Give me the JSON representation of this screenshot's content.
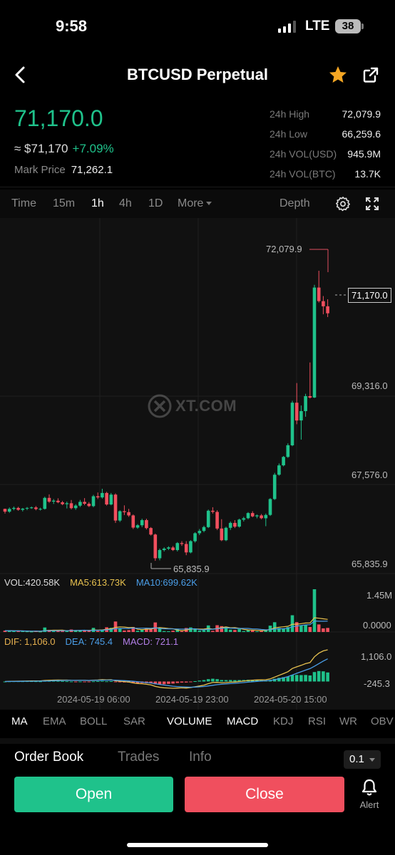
{
  "status_bar": {
    "time": "9:58",
    "network": "LTE",
    "battery": "38"
  },
  "header": {
    "title": "BTCUSD Perpetual"
  },
  "price": {
    "last": "71,170.0",
    "approx": "≈ $71,170",
    "change": "+7.09%",
    "mark_label": "Mark Price",
    "mark_value": "71,262.1"
  },
  "stats": [
    {
      "label": "24h High",
      "value": "72,079.9"
    },
    {
      "label": "24h Low",
      "value": "66,259.6"
    },
    {
      "label": "24h VOL(USD)",
      "value": "945.9M"
    },
    {
      "label": "24h VOL(BTC)",
      "value": "13.7K"
    }
  ],
  "timeframes": [
    "Time",
    "15m",
    "1h",
    "4h",
    "1D",
    "More"
  ],
  "timeframe_active": "1h",
  "depth_label": "Depth",
  "chart": {
    "price_labels": [
      "69,316.0",
      "67,576.0",
      "65,835.9"
    ],
    "high_marker": "72,079.9",
    "low_marker": "65,835.9",
    "current_tag": "71,170.0",
    "watermark": "XT.COM",
    "vol_legend": {
      "vol": "VOL:420.58K",
      "ma5": "MA5:613.73K",
      "ma10": "MA10:699.62K"
    },
    "vol_axis": [
      "1.45M",
      "0.0000"
    ],
    "macd_legend": {
      "dif": "DIF: 1,106.0",
      "dea": "DEA: 745.4",
      "macd": "MACD: 721.1"
    },
    "macd_axis": [
      "1,106.0",
      "-245.3"
    ],
    "dates": [
      "2024-05-19 06:00",
      "2024-05-19 23:00",
      "2024-05-20 15:00"
    ]
  },
  "indicators": [
    "MA",
    "EMA",
    "BOLL",
    "SAR",
    "VOLUME",
    "MACD",
    "KDJ",
    "RSI",
    "WR",
    "OBV"
  ],
  "indicators_active": [
    "MA",
    "VOLUME",
    "MACD"
  ],
  "bottom_tabs": [
    "Order Book",
    "Trades",
    "Info"
  ],
  "bottom_tab_active": "Order Book",
  "precision": "0.1",
  "buttons": {
    "open": "Open",
    "close": "Close",
    "alert": "Alert"
  },
  "colors": {
    "up": "#1fc28b",
    "down": "#f04f5e",
    "star": "#f5a623"
  },
  "chart_data": {
    "type": "candlestick",
    "x_ticks": [
      "2024-05-19 06:00",
      "2024-05-19 23:00",
      "2024-05-20 15:00"
    ],
    "price_range": [
      65835.9,
      72079.9
    ],
    "high": 72079.9,
    "low": 65835.9,
    "last": 71170.0,
    "candles": [
      [
        66990,
        66995,
        66890,
        66930
      ],
      [
        66930,
        67020,
        66905,
        66990
      ],
      [
        66990,
        67040,
        66960,
        67010
      ],
      [
        67010,
        67035,
        66950,
        66970
      ],
      [
        66970,
        67010,
        66935,
        66995
      ],
      [
        66995,
        67030,
        66965,
        67010
      ],
      [
        67010,
        67040,
        66990,
        67020
      ],
      [
        67020,
        67050,
        66960,
        66985
      ],
      [
        66985,
        67015,
        66955,
        66990
      ],
      [
        66990,
        67250,
        66975,
        67225
      ],
      [
        67225,
        67300,
        67120,
        67145
      ],
      [
        67145,
        67200,
        67095,
        67165
      ],
      [
        67165,
        67215,
        67110,
        67130
      ],
      [
        67130,
        67160,
        67070,
        67090
      ],
      [
        67090,
        67145,
        67000,
        67110
      ],
      [
        67110,
        67180,
        66980,
        67005
      ],
      [
        67005,
        67090,
        66970,
        67060
      ],
      [
        67060,
        67180,
        67030,
        67140
      ],
      [
        67140,
        67220,
        67070,
        67100
      ],
      [
        67100,
        67135,
        67030,
        67050
      ],
      [
        67050,
        67290,
        67025,
        67260
      ],
      [
        67260,
        67340,
        67200,
        67235
      ],
      [
        67235,
        67420,
        67210,
        67330
      ],
      [
        67330,
        67355,
        67060,
        67085
      ],
      [
        67085,
        67330,
        67065,
        67295
      ],
      [
        67295,
        67320,
        66690,
        66740
      ],
      [
        66740,
        66960,
        66710,
        66940
      ],
      [
        66940,
        67065,
        66860,
        66920
      ],
      [
        66920,
        66990,
        66820,
        66850
      ],
      [
        66850,
        66870,
        66560,
        66590
      ],
      [
        66590,
        66665,
        66565,
        66640
      ],
      [
        66640,
        66780,
        66600,
        66750
      ],
      [
        66750,
        66780,
        66550,
        66580
      ],
      [
        66580,
        66600,
        66420,
        66440
      ],
      [
        66440,
        66460,
        65880,
        65935
      ],
      [
        65935,
        66140,
        65890,
        66110
      ],
      [
        66110,
        66170,
        66080,
        66140
      ],
      [
        66140,
        66190,
        66110,
        66165
      ],
      [
        66165,
        66195,
        66090,
        66110
      ],
      [
        66110,
        66280,
        66080,
        66260
      ],
      [
        66260,
        66300,
        66200,
        66240
      ],
      [
        66240,
        66300,
        66000,
        66060
      ],
      [
        66060,
        66320,
        66040,
        66300
      ],
      [
        66300,
        66490,
        66270,
        66470
      ],
      [
        66470,
        66560,
        66430,
        66520
      ],
      [
        66520,
        66630,
        66490,
        66600
      ],
      [
        66600,
        66975,
        66580,
        66950
      ],
      [
        66950,
        67025,
        66890,
        66925
      ],
      [
        66925,
        66960,
        66540,
        66570
      ],
      [
        66570,
        66770,
        66300,
        66320
      ],
      [
        66320,
        66610,
        66300,
        66585
      ],
      [
        66585,
        66720,
        66540,
        66690
      ],
      [
        66690,
        66750,
        66580,
        66610
      ],
      [
        66610,
        66780,
        66590,
        66760
      ],
      [
        66760,
        66820,
        66720,
        66790
      ],
      [
        66790,
        66920,
        66770,
        66900
      ],
      [
        66900,
        66940,
        66810,
        66830
      ],
      [
        66830,
        66870,
        66790,
        66850
      ],
      [
        66850,
        66880,
        66770,
        66790
      ],
      [
        66790,
        66890,
        66620,
        66860
      ],
      [
        66860,
        67220,
        66840,
        67200
      ],
      [
        67200,
        67760,
        67180,
        67720
      ],
      [
        67720,
        67960,
        67700,
        67920
      ],
      [
        67920,
        68120,
        67900,
        68100
      ],
      [
        68100,
        68390,
        68080,
        68350
      ],
      [
        68350,
        69300,
        68330,
        69260
      ],
      [
        69260,
        69680,
        68800,
        68880
      ],
      [
        68880,
        69200,
        68470,
        69080
      ],
      [
        69080,
        69450,
        68960,
        69400
      ],
      [
        69400,
        70120,
        69350,
        69370
      ],
      [
        69370,
        71780,
        69360,
        71720
      ],
      [
        71720,
        72080,
        71400,
        71430
      ],
      [
        71430,
        71540,
        71150,
        71320
      ],
      [
        71320,
        71470,
        71090,
        71170
      ]
    ]
  }
}
